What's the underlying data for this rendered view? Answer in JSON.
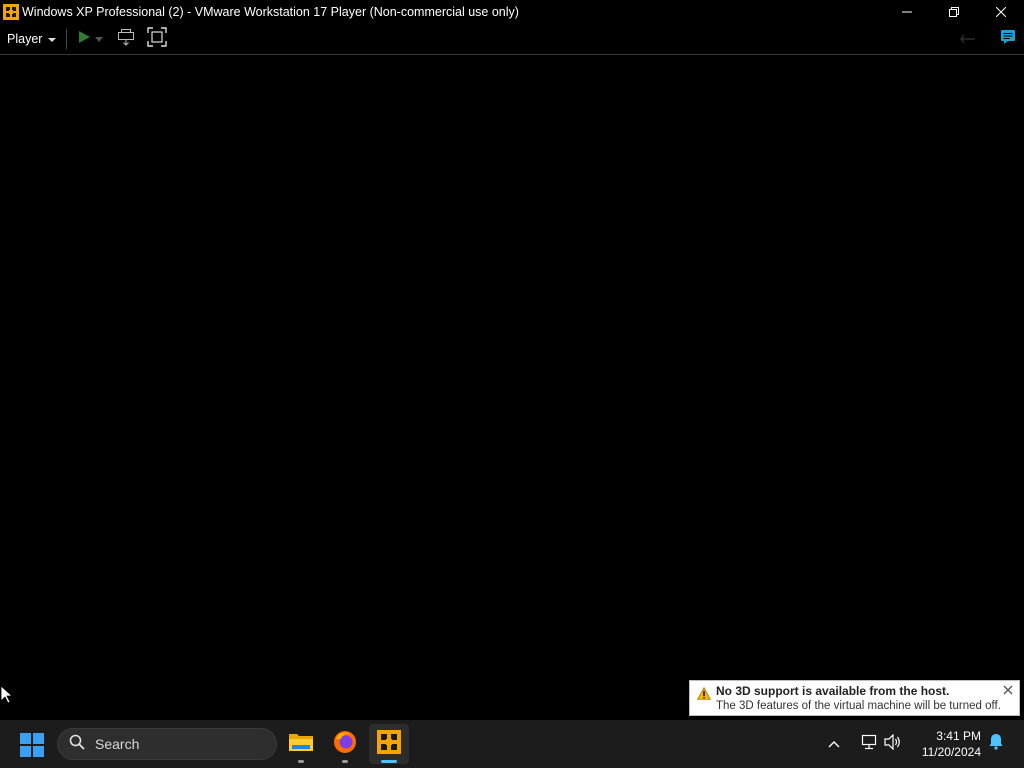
{
  "window": {
    "title": "Windows XP Professional (2) - VMware Workstation 17 Player (Non-commercial use only)",
    "icon": "vmware-icon",
    "minimize_icon": "minimize-icon",
    "restore_icon": "restore-icon",
    "close_icon": "close-icon"
  },
  "toolbar": {
    "player_label": "Player",
    "items": [
      "play-icon",
      "send-ctrl-alt-del-icon",
      "fullscreen-icon",
      "unity-icon",
      "message-log-icon"
    ]
  },
  "notification": {
    "icon": "warning-icon",
    "title": "No 3D support is available from the host.",
    "body": "The 3D features of the virtual machine will be turned off.",
    "close_icon": "close-icon"
  },
  "taskbar": {
    "search_placeholder": "Search",
    "apps": [
      "file-explorer-icon",
      "firefox-icon",
      "vmware-player-icon"
    ],
    "active_app": "vmware-player-icon",
    "tray": [
      "chevron-up-icon",
      "network-icon",
      "volume-icon",
      "notification-bell-icon"
    ],
    "time": "3:41 PM",
    "date": "11/20/2024"
  },
  "colors": {
    "accent": "#4cc2ff",
    "start": "#3aa0f3",
    "play_green": "#2e7d32",
    "warning": "#f4b400",
    "toolbar_accent": "#1aa3d9"
  }
}
